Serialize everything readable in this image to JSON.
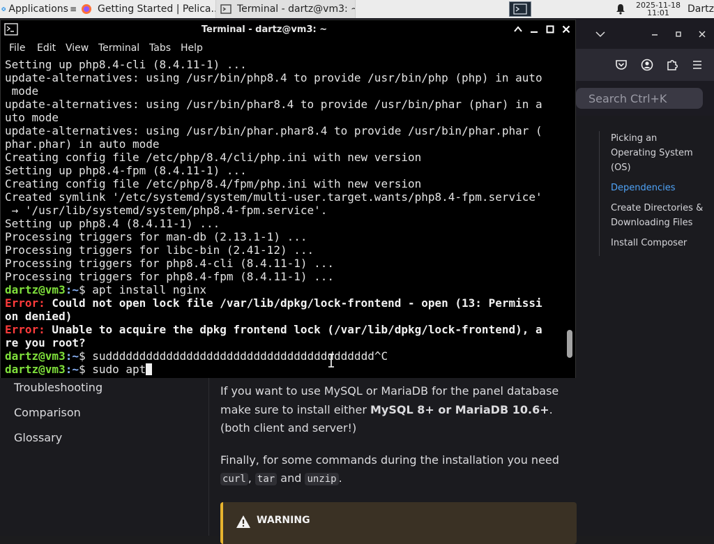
{
  "panel": {
    "applications_label": "Applications",
    "tasks": [
      {
        "label": "Getting Started | Pelica...",
        "icon": "firefox-icon"
      },
      {
        "label": "Terminal - dartz@vm3: ~",
        "icon": "terminal-icon"
      }
    ],
    "clock_date": "2025-11-18",
    "clock_time": "11:01",
    "user": "Dartz"
  },
  "browser": {
    "search_placeholder": "Search Ctrl+K",
    "toc": [
      {
        "label": "Picking an Operating System (OS)",
        "active": false
      },
      {
        "label": "Dependencies",
        "active": true
      },
      {
        "label": "Create Directories & Downloading Files",
        "active": false
      },
      {
        "label": "Install Composer",
        "active": false
      }
    ],
    "nav_items": [
      "Troubleshooting",
      "Comparison",
      "Glossary"
    ],
    "content": {
      "para1_text": "If you want to use MySQL or MariaDB for the panel database make sure to install either ",
      "para1_bold": "MySQL 8+ or MariaDB 10.6+",
      "para1_end": ". (both client and server!)",
      "para2_text": "Finally, for some commands during the installation you need ",
      "code1": "curl",
      "sep1": ", ",
      "code2": "tar",
      "sep2": " and ",
      "code3": "unzip",
      "para2_end": "."
    },
    "warning_label": "WARNING",
    "accent": "#4fa3f7",
    "warning_color": "#e6b32e"
  },
  "terminal": {
    "title": "Terminal - dartz@vm3: ~",
    "menu": [
      "File",
      "Edit",
      "View",
      "Terminal",
      "Tabs",
      "Help"
    ],
    "scroll_position_fraction": 0.95,
    "lines": [
      {
        "kind": "out",
        "text": "Setting up php8.4-cli (8.4.11-1) ..."
      },
      {
        "kind": "out",
        "text": "update-alternatives: using /usr/bin/php8.4 to provide /usr/bin/php (php) in auto"
      },
      {
        "kind": "out",
        "text": " mode"
      },
      {
        "kind": "out",
        "text": "update-alternatives: using /usr/bin/phar8.4 to provide /usr/bin/phar (phar) in a"
      },
      {
        "kind": "out",
        "text": "uto mode"
      },
      {
        "kind": "out",
        "text": "update-alternatives: using /usr/bin/phar.phar8.4 to provide /usr/bin/phar.phar ("
      },
      {
        "kind": "out",
        "text": "phar.phar) in auto mode"
      },
      {
        "kind": "out",
        "text": "Creating config file /etc/php/8.4/cli/php.ini with new version"
      },
      {
        "kind": "out",
        "text": "Setting up php8.4-fpm (8.4.11-1) ..."
      },
      {
        "kind": "out",
        "text": "Creating config file /etc/php/8.4/fpm/php.ini with new version"
      },
      {
        "kind": "out",
        "text": "Created symlink '/etc/systemd/system/multi-user.target.wants/php8.4-fpm.service'"
      },
      {
        "kind": "out",
        "text": " → '/usr/lib/systemd/system/php8.4-fpm.service'."
      },
      {
        "kind": "out",
        "text": "Setting up php8.4 (8.4.11-1) ..."
      },
      {
        "kind": "out",
        "text": "Processing triggers for man-db (2.13.1-1) ..."
      },
      {
        "kind": "out",
        "text": "Processing triggers for libc-bin (2.41-12) ..."
      },
      {
        "kind": "out",
        "text": "Processing triggers for php8.4-cli (8.4.11-1) ..."
      },
      {
        "kind": "out",
        "text": "Processing triggers for php8.4-fpm (8.4.11-1) ..."
      },
      {
        "kind": "prompt",
        "user": "dartz@vm3",
        "path": "~",
        "sym": "$ ",
        "cmd": "apt install nginx"
      },
      {
        "kind": "err",
        "label": "Error:",
        "text": " Could not open lock file /var/lib/dpkg/lock-frontend - open (13: Permissi"
      },
      {
        "kind": "errcont",
        "text": "on denied)"
      },
      {
        "kind": "err",
        "label": "Error:",
        "text": " Unable to acquire the dpkg frontend lock (/var/lib/dpkg/lock-frontend), a"
      },
      {
        "kind": "errcont",
        "text": "re you root?"
      },
      {
        "kind": "prompt",
        "user": "dartz@vm3",
        "path": "~",
        "sym": "$ ",
        "cmd": "sudddddddddddddddddddddddddddddddddddddddd^C"
      },
      {
        "kind": "prompt",
        "user": "dartz@vm3",
        "path": "~",
        "sym": "$ ",
        "cmd": "sudo apt",
        "cursor": true
      }
    ]
  }
}
